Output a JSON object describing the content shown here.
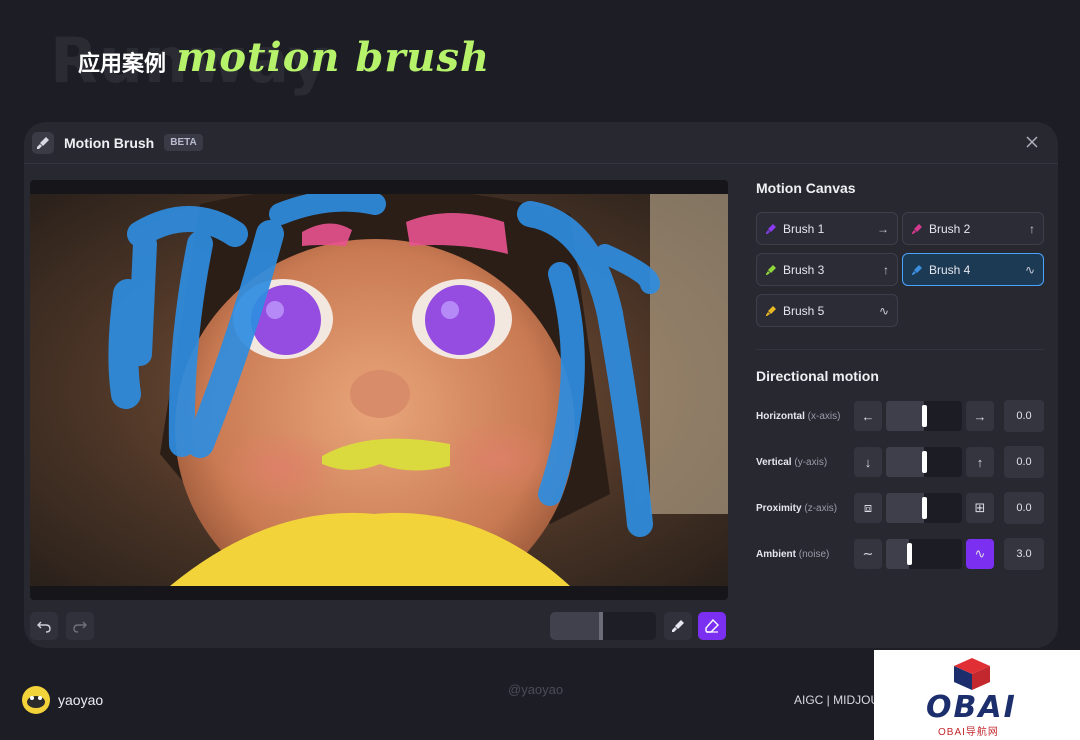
{
  "slide": {
    "ghost_word": "Runway",
    "title_cn": "应用案例",
    "title_en": "motion brush"
  },
  "panel": {
    "title": "Motion Brush",
    "badge": "BETA",
    "icons": {
      "brush": "brush-icon",
      "close": "close-icon"
    }
  },
  "canvas": {
    "brushes_painted": [
      "blue hair strokes",
      "pink brows",
      "purple eyes",
      "yellow lips",
      "yellow sweater"
    ]
  },
  "toolbar": {
    "undo_icon": "undo-icon",
    "redo_icon": "redo-icon",
    "brush_size_fraction": 0.48,
    "brush_tool_icon": "brush-icon",
    "eraser_tool_icon": "eraser-icon"
  },
  "motion_canvas": {
    "title": "Motion Canvas",
    "brushes": [
      {
        "label": "Brush 1",
        "dir": "→",
        "color": "#8b3bf0",
        "active": false
      },
      {
        "label": "Brush 2",
        "dir": "↑",
        "color": "#d63a8f",
        "active": false
      },
      {
        "label": "Brush 3",
        "dir": "↑",
        "color": "#8fd63a",
        "active": false
      },
      {
        "label": "Brush 4",
        "dir": "∿",
        "color": "#3a8fe0",
        "active": true
      },
      {
        "label": "Brush 5",
        "dir": "∿",
        "color": "#e8b923",
        "active": false
      }
    ]
  },
  "directional_motion": {
    "title": "Directional motion",
    "rows": [
      {
        "label": "Horizontal",
        "axis": "(x-axis)",
        "left_icon": "←",
        "right_icon": "→",
        "value": "0.0",
        "knob": 0.5
      },
      {
        "label": "Vertical",
        "axis": "(y-axis)",
        "left_icon": "↓",
        "right_icon": "↑",
        "value": "0.0",
        "knob": 0.5
      },
      {
        "label": "Proximity",
        "axis": "(z-axis)",
        "left_icon": "⧈",
        "right_icon": "⊞",
        "value": "0.0",
        "knob": 0.5
      },
      {
        "label": "Ambient",
        "axis": "(noise)",
        "left_icon": "∼",
        "right_icon": "∿",
        "value": "3.0",
        "knob": 0.3
      }
    ]
  },
  "footer": {
    "author": "yaoyao",
    "handle": "@yaoyao",
    "tags": "AIGC | MIDJOU",
    "logo_text": "OBAI",
    "logo_sub": "OBAI导航网",
    "colors": {
      "accent": "#b6f36b",
      "purple": "#7b2ff0",
      "active_border": "#4aa4ff"
    }
  }
}
